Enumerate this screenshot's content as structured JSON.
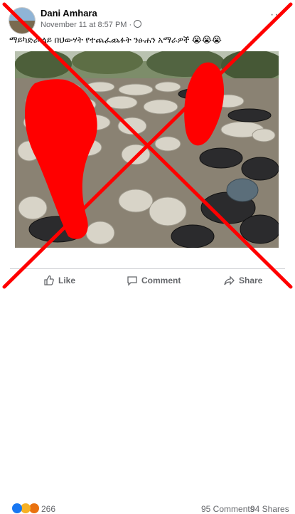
{
  "post": {
    "author": "Dani Amhara",
    "meta": "November 11 at 8:57 PM ·",
    "caption": "ማይካድራ ላይ በህውሃት የተጨፈጨፉት ንፁሐን አማራዎች 😭😭😭"
  },
  "stats": {
    "reaction_count": "266",
    "comments": "95 Comments",
    "shares": "94 Shares",
    "reactions": [
      "like-icon",
      "sad-icon",
      "angry-icon"
    ]
  },
  "actions": {
    "like": "Like",
    "comment": "Comment",
    "share": "Share"
  },
  "colors": {
    "overlay_red": "#ff0000",
    "fb_blue": "#1877f2",
    "text_secondary": "#65676b"
  }
}
